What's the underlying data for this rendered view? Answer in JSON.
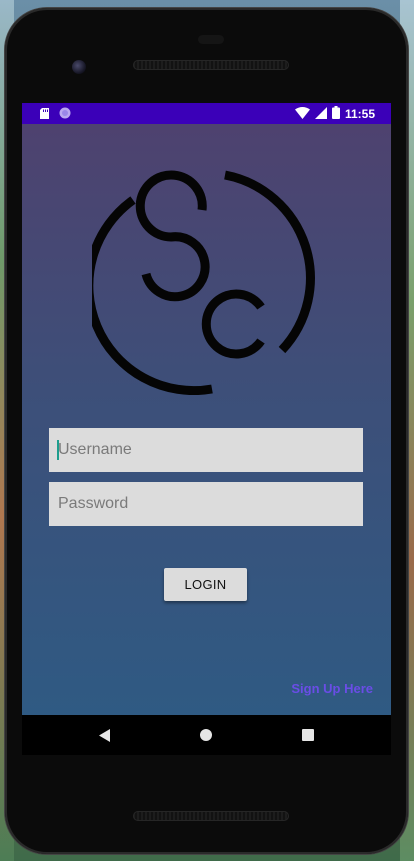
{
  "status_bar": {
    "time": "11:55",
    "left_icons": [
      "sd-card-icon",
      "circle-indicator-icon"
    ],
    "right_icons": [
      "wifi-icon",
      "cellular-signal-icon",
      "battery-icon"
    ],
    "background_color": "#3b00b8"
  },
  "app": {
    "logo": {
      "text": "SC",
      "icon": "sc-logo-icon"
    },
    "username_field": {
      "placeholder": "Username",
      "value": ""
    },
    "password_field": {
      "placeholder": "Password",
      "value": ""
    },
    "login_button_label": "LOGIN",
    "signup_link_label": "Sign Up Here",
    "colors": {
      "gradient_top": "#4e426f",
      "gradient_bottom": "#2f5a83",
      "link": "#6a4de6",
      "field_background": "#dcdcdc"
    }
  },
  "navigation_bar": {
    "buttons": [
      "back-icon",
      "home-icon",
      "recents-icon"
    ]
  }
}
